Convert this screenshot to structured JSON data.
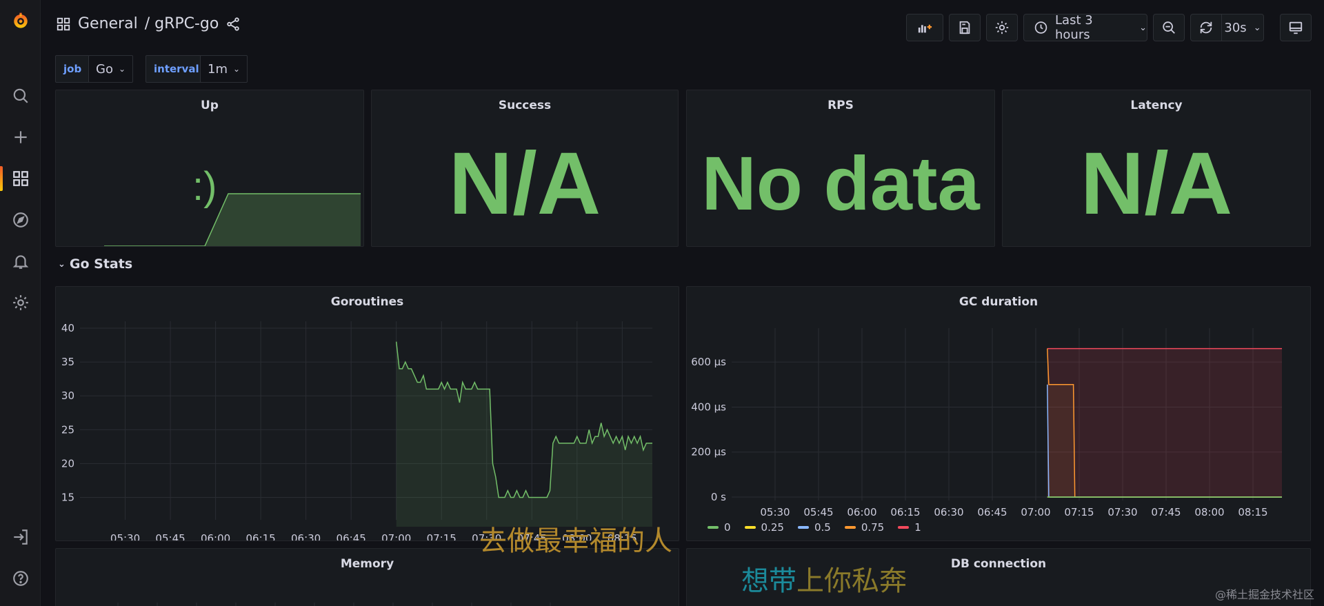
{
  "topbar": {
    "breadcrumb_folder": "General",
    "breadcrumb_dashboard": "/ gRPC-go",
    "time_range": "Last 3 hours",
    "refresh_interval": "30s"
  },
  "variables": [
    {
      "label": "job",
      "value": "Go"
    },
    {
      "label": "interval",
      "value": "1m"
    }
  ],
  "panels": {
    "up": {
      "title": "Up",
      "glyph": ":)"
    },
    "success": {
      "title": "Success",
      "value": "N/A"
    },
    "rps": {
      "title": "RPS",
      "value": "No data"
    },
    "latency": {
      "title": "Latency",
      "value": "N/A"
    },
    "memory": {
      "title": "Memory"
    },
    "db": {
      "title": "DB connection"
    }
  },
  "row": {
    "title": "Go Stats"
  },
  "colors": {
    "green": "#73bf69",
    "yellow": "#fade2a",
    "blue": "#8ab8ff",
    "orange": "#ff9830",
    "red": "#f2495c"
  },
  "chart_data": [
    {
      "type": "line",
      "title": "Goroutines",
      "x_tick_labels": [
        "05:30",
        "05:45",
        "06:00",
        "06:15",
        "06:30",
        "06:45",
        "07:00",
        "07:15",
        "07:30",
        "07:45",
        "08:00",
        "08:15"
      ],
      "y_tick_labels": [
        "40",
        "35",
        "30",
        "25",
        "20",
        "15"
      ],
      "ylim": [
        12.5,
        40
      ],
      "x_range_minutes": [
        315,
        505
      ],
      "grid": true,
      "series": [
        {
          "x_minutes": [
            420,
            421,
            422,
            423,
            424,
            425,
            426,
            427,
            428,
            429,
            430,
            431,
            432,
            433,
            434,
            435,
            436,
            437,
            438,
            439,
            440,
            441,
            442,
            443,
            444,
            445,
            446,
            447,
            448,
            449,
            450,
            451,
            452,
            453,
            454,
            455,
            456,
            457,
            458,
            459,
            460,
            461,
            462,
            463,
            464,
            465,
            466,
            467,
            468,
            469,
            470,
            471,
            472,
            473,
            474,
            475,
            476,
            477,
            478,
            479,
            480,
            481,
            482,
            483,
            484,
            485,
            486,
            487,
            488,
            489,
            490,
            491,
            492,
            493,
            494,
            495,
            496,
            497,
            498,
            499,
            500,
            501,
            502,
            503,
            504,
            505
          ],
          "values": [
            38,
            34,
            34,
            35,
            34,
            34,
            33,
            32,
            32,
            33,
            31,
            31,
            31,
            31,
            31,
            32,
            31,
            32,
            31,
            31,
            31,
            29,
            32,
            31,
            31,
            31,
            32,
            31,
            31,
            31,
            31,
            31,
            20,
            18,
            15,
            15,
            15,
            16,
            15,
            15,
            16,
            15,
            15,
            16,
            15,
            15,
            15,
            15,
            15,
            15,
            15,
            16,
            23,
            24,
            23,
            23,
            23,
            23,
            23,
            23,
            24,
            23,
            23,
            23,
            25,
            23,
            24,
            24,
            26,
            24,
            25,
            24,
            23,
            24,
            23,
            24,
            22,
            24,
            23,
            24,
            23,
            24,
            22,
            23,
            23,
            23
          ]
        }
      ]
    },
    {
      "type": "area",
      "title": "GC duration",
      "x_tick_labels": [
        "05:30",
        "05:45",
        "06:00",
        "06:15",
        "06:30",
        "06:45",
        "07:00",
        "07:15",
        "07:30",
        "07:45",
        "08:00",
        "08:15"
      ],
      "y_tick_labels": [
        "600 µs",
        "400 µs",
        "200 µs",
        "0 s"
      ],
      "ylim": [
        0,
        720
      ],
      "x_range_minutes": [
        315,
        505
      ],
      "grid": true,
      "legend": "bottom",
      "series": [
        {
          "name": "0",
          "color": "#73bf69",
          "x_minutes": [
            424,
            424.5,
            505
          ],
          "values": [
            0,
            0,
            0
          ]
        },
        {
          "name": "0.25",
          "color": "#fade2a",
          "x_minutes": [
            424,
            424.5,
            505
          ],
          "values": [
            0,
            0,
            0
          ]
        },
        {
          "name": "0.5",
          "color": "#8ab8ff",
          "x_minutes": [
            424,
            424.5,
            425,
            505
          ],
          "values": [
            500,
            0,
            0,
            0
          ]
        },
        {
          "name": "0.75",
          "color": "#ff9830",
          "x_minutes": [
            424,
            424.5,
            433,
            433.5,
            505
          ],
          "values": [
            660,
            500,
            500,
            0,
            0
          ]
        },
        {
          "name": "1",
          "color": "#f2495c",
          "x_minutes": [
            424,
            505
          ],
          "values": [
            660,
            660
          ]
        }
      ]
    }
  ],
  "overlay": {
    "line1": "去做最幸福的人",
    "line2_part1": "想带",
    "line2_part2": "上你私奔"
  },
  "watermark": "@稀土掘金技术社区"
}
